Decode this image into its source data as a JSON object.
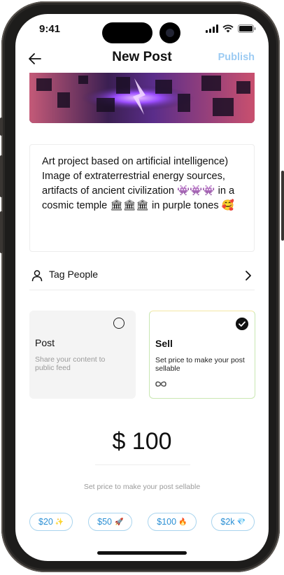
{
  "status": {
    "time": "9:41"
  },
  "header": {
    "title": "New Post",
    "publish_label": "Publish"
  },
  "post": {
    "caption": "Art project based on artificial intelligence) Image of extraterrestrial energy sources, artifacts of ancient civilization 👾👾👾 in a cosmic temple 🏛🏛🏛 in purple tones 🥰"
  },
  "tag_people": {
    "label": "Tag People"
  },
  "options": [
    {
      "title": "Post",
      "desc": "Share your content to public feed",
      "selected": false
    },
    {
      "title": "Sell",
      "desc": "Set price to make your post sellable",
      "selected": true
    }
  ],
  "price": {
    "value": "$ 100",
    "hint": "Set price to make your post sellable"
  },
  "chips": [
    {
      "label": "$20",
      "emoji": "✨"
    },
    {
      "label": "$50",
      "emoji": "🚀"
    },
    {
      "label": "$100",
      "emoji": "🔥"
    },
    {
      "label": "$2k",
      "emoji": "💎"
    }
  ],
  "colors": {
    "accent": "#2a8fd4",
    "publish_disabled": "#9ccbf3",
    "sell_border": "#c9e7b2"
  },
  "icons": [
    "back-arrow-icon",
    "signal-icon",
    "wifi-icon",
    "battery-icon",
    "person-icon",
    "chevron-right-icon",
    "radio-empty-icon",
    "check-circle-icon",
    "infinity-icon"
  ]
}
